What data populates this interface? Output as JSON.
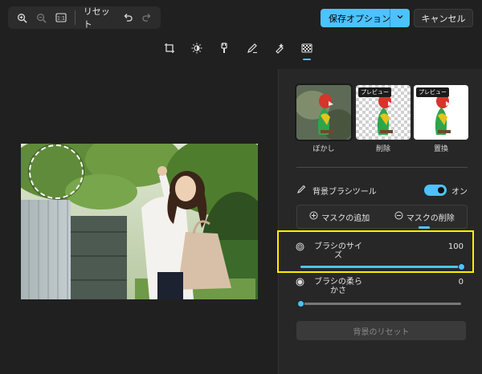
{
  "toolbar": {
    "reset_label": "リセット"
  },
  "header": {
    "save_label": "保存オプション",
    "cancel_label": "キャンセル"
  },
  "tools": [
    "crop-icon",
    "brightness-icon",
    "filter-icon",
    "markup-icon",
    "remove-icon",
    "background-icon"
  ],
  "panel": {
    "thumbs": [
      {
        "label": "ぼかし",
        "badge": ""
      },
      {
        "label": "削除",
        "badge": "プレビュー"
      },
      {
        "label": "置換",
        "badge": "プレビュー"
      }
    ],
    "brush_tool_label": "背景ブラシツール",
    "brush_tool_state": "オン",
    "mask_add_label": "マスクの追加",
    "mask_remove_label": "マスクの削除",
    "brush_size_label": "ブラシのサイズ",
    "brush_size_value": "100",
    "brush_size_level": 1.0,
    "brush_softness_label": "ブラシの柔らかさ",
    "brush_softness_value": "0",
    "brush_softness_level": 0.0,
    "reset_bg_label": "背景のリセット"
  },
  "colors": {
    "accent": "#4cc2ff",
    "highlight": "#ffee00",
    "background": "#202020"
  }
}
